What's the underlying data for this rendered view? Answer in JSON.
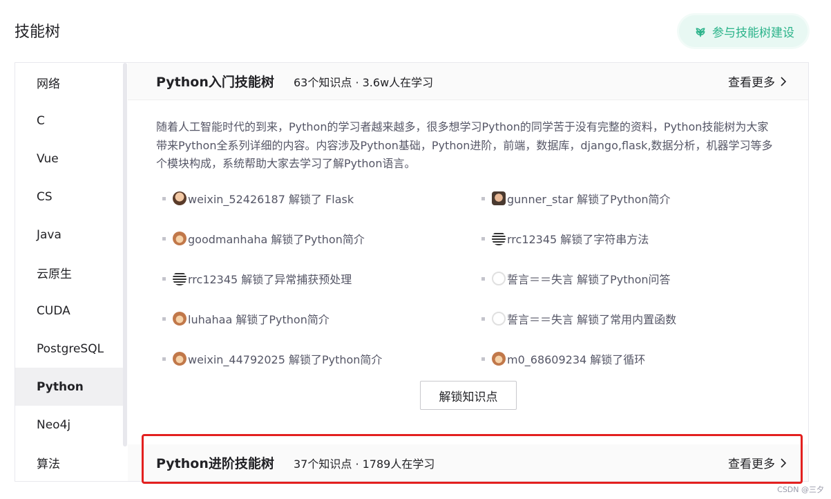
{
  "page": {
    "title": "技能树"
  },
  "contribute": {
    "label": "参与技能树建设",
    "icon": "leaf-icon",
    "color": "#2bb38a"
  },
  "sidebar": {
    "items": [
      {
        "label": "网络"
      },
      {
        "label": "C"
      },
      {
        "label": "Vue"
      },
      {
        "label": "CS"
      },
      {
        "label": "Java"
      },
      {
        "label": "云原生"
      },
      {
        "label": "CUDA"
      },
      {
        "label": "PostgreSQL"
      },
      {
        "label": "Python",
        "active": true
      },
      {
        "label": "Neo4j"
      },
      {
        "label": "算法"
      }
    ]
  },
  "trees": [
    {
      "title": "Python入门技能树",
      "stats": "63个知识点 · 3.6w人在学习",
      "more": "查看更多",
      "description": "随着人工智能时代的到来，Python的学习者越来越多，很多想学习Python的同学苦于没有完整的资料，Python技能树为大家带来Python全系列详细的内容。内容涉及Python基础，Python进阶，前端，数据库，django,flask,数据分析，机器学习等多个模块构成，系统帮助大家去学习了解Python语言。",
      "activities": [
        {
          "text": "weixin_52426187 解锁了 Flask"
        },
        {
          "text": "gunner_star 解锁了Python简介"
        },
        {
          "text": "goodmanhaha 解锁了Python简介"
        },
        {
          "text": "rrc12345 解锁了字符串方法"
        },
        {
          "text": "rrc12345 解锁了异常捕获预处理"
        },
        {
          "text": "誓言＝＝失言 解锁了Python问答"
        },
        {
          "text": "luhahaa 解锁了Python简介"
        },
        {
          "text": "誓言＝＝失言 解锁了常用内置函数"
        },
        {
          "text": "weixin_44792025 解锁了Python简介"
        },
        {
          "text": "m0_68609234 解锁了循环"
        }
      ],
      "unlock_button": "解锁知识点"
    },
    {
      "title": "Python进阶技能树",
      "stats": "37个知识点 · 1789人在学习",
      "more": "查看更多"
    }
  ],
  "watermark": "CSDN @三夕",
  "colors": {
    "highlight": "#e3201f",
    "accent": "#2bb38a"
  }
}
